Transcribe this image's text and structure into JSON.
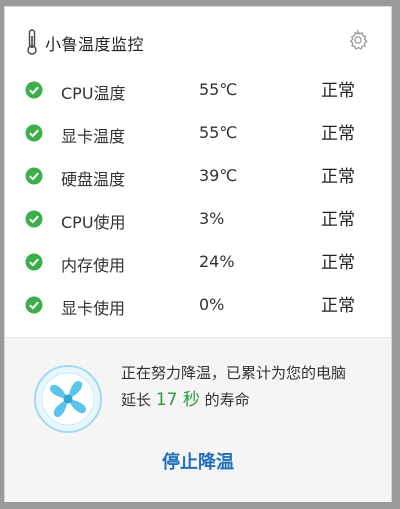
{
  "app": {
    "title": "小鲁温度监控",
    "thermometer_icon": "thermometer-icon",
    "settings_icon": "gear-icon"
  },
  "colors": {
    "ok_green": "#3cae4a",
    "seconds_green": "#2e9a3a",
    "action_blue": "#1f6fba",
    "fan_blue": "#5bc4ea"
  },
  "metrics": [
    {
      "label": "CPU温度",
      "value": "55℃",
      "status": "正常"
    },
    {
      "label": "显卡温度",
      "value": "55℃",
      "status": "正常"
    },
    {
      "label": "硬盘温度",
      "value": "39℃",
      "status": "正常"
    },
    {
      "label": "CPU使用",
      "value": "3%",
      "status": "正常"
    },
    {
      "label": "内存使用",
      "value": "24%",
      "status": "正常"
    },
    {
      "label": "显卡使用",
      "value": "0%",
      "status": "正常"
    }
  ],
  "cooling": {
    "line1": "正在努力降温，已累计为您的电脑",
    "line2_prefix": "延长",
    "seconds": "17 秒",
    "line2_suffix": "的寿命",
    "fan_icon": "fan-icon",
    "stop_label": "停止降温"
  }
}
